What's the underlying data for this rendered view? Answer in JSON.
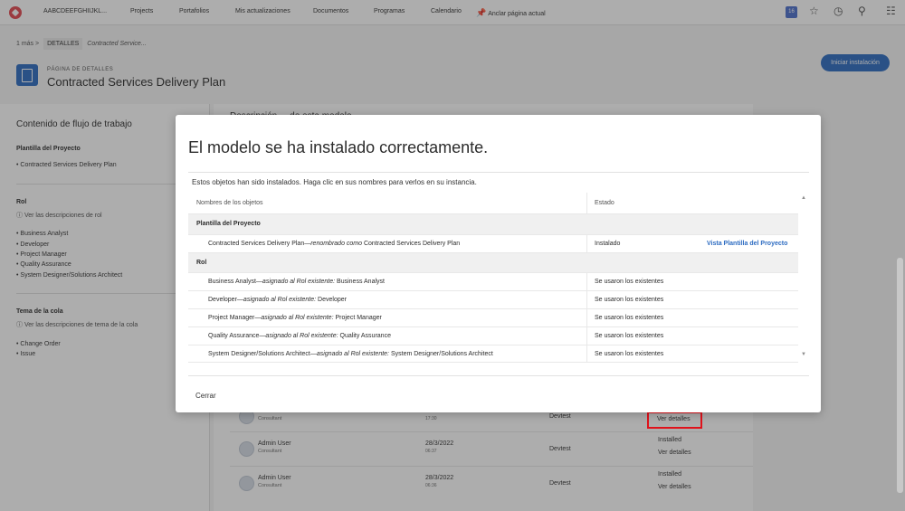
{
  "topnav": {
    "workspace": "AABCDEEFGHIIJKL...",
    "links": [
      "Projects",
      "Portafolios",
      "Mis actualizaciones",
      "Documentos",
      "Programas",
      "Calendario"
    ],
    "pin_label": "Anclar página actual",
    "notification_count": "16"
  },
  "breadcrumb": {
    "more": "1 más",
    "sep": ">",
    "section": "DETALLES",
    "current": "Contracted Service..."
  },
  "header": {
    "kicker": "PÁGINA DE DETALLES",
    "title": "Contracted Services Delivery Plan",
    "install_button": "Iniciar instalación"
  },
  "left_panel": {
    "title": "Contenido de flujo de trabajo",
    "template_heading": "Plantilla del Proyecto",
    "template_items": [
      "Contracted Services Delivery Plan"
    ],
    "role_heading": "Rol",
    "role_info": "Ver las descripciones de rol",
    "role_items": [
      "Business Analyst",
      "Developer",
      "Project Manager",
      "Quality Assurance",
      "System Designer/Solutions Architect"
    ],
    "queue_heading": "Tema de la cola",
    "queue_info": "Ver las descripciones de tema de la cola",
    "queue_items": [
      "Change Order",
      "Issue"
    ]
  },
  "background": {
    "heading": "Descripción ... de esta modelo",
    "rows": [
      {
        "name": "Admin User",
        "role": "Consultant",
        "date": "28/3/2022",
        "time": "17:30",
        "org": "Devtest",
        "status": "",
        "link": "Ver detalles"
      },
      {
        "name": "Admin User",
        "role": "Consultant",
        "date": "28/3/2022",
        "time": "06:37",
        "org": "Devtest",
        "status": "Installed",
        "link": "Ver detalles"
      },
      {
        "name": "Admin User",
        "role": "Consultant",
        "date": "28/3/2022",
        "time": "06:36",
        "org": "Devtest",
        "status": "Installed",
        "link": "Ver detalles"
      }
    ]
  },
  "modal": {
    "title": "El modelo se ha instalado correctamente.",
    "intro": "Estos objetos han sido instalados. Haga clic en sus nombres para verlos en su instancia.",
    "col_name": "Nombres de los objetos",
    "col_status": "Estado",
    "group_template": "Plantilla del Proyecto",
    "template_row": {
      "name": "Contracted Services Delivery Plan",
      "rel": "—renombrado como",
      "target": "Contracted Services Delivery Plan",
      "status": "Instalado",
      "link": "Vista Plantilla del Proyecto"
    },
    "group_role": "Rol",
    "role_rel": "—asignado al Rol existente:",
    "role_rows": [
      {
        "name": "Business Analyst",
        "target": "Business Analyst",
        "status": "Se usaron los existentes"
      },
      {
        "name": "Developer",
        "target": "Developer",
        "status": "Se usaron los existentes"
      },
      {
        "name": "Project Manager",
        "target": "Project Manager",
        "status": "Se usaron los existentes"
      },
      {
        "name": "Quality Assurance",
        "target": "Quality Assurance",
        "status": "Se usaron los existentes"
      },
      {
        "name": "System Designer/Solutions Architect",
        "target": "System Designer/Solutions Architect",
        "status": "Se usaron los existentes"
      }
    ],
    "close_label": "Cerrar"
  },
  "highlighted_link": "Ver detalles",
  "colors": {
    "accent": "#2c6bc1",
    "highlight": "#e0121b",
    "logo": "#e34850"
  },
  "icons": [
    "logo-icon",
    "pin-icon",
    "star-icon",
    "history-icon",
    "search-icon",
    "apps-grid-icon",
    "info-icon",
    "chevron-up-icon",
    "chevron-down-icon"
  ]
}
